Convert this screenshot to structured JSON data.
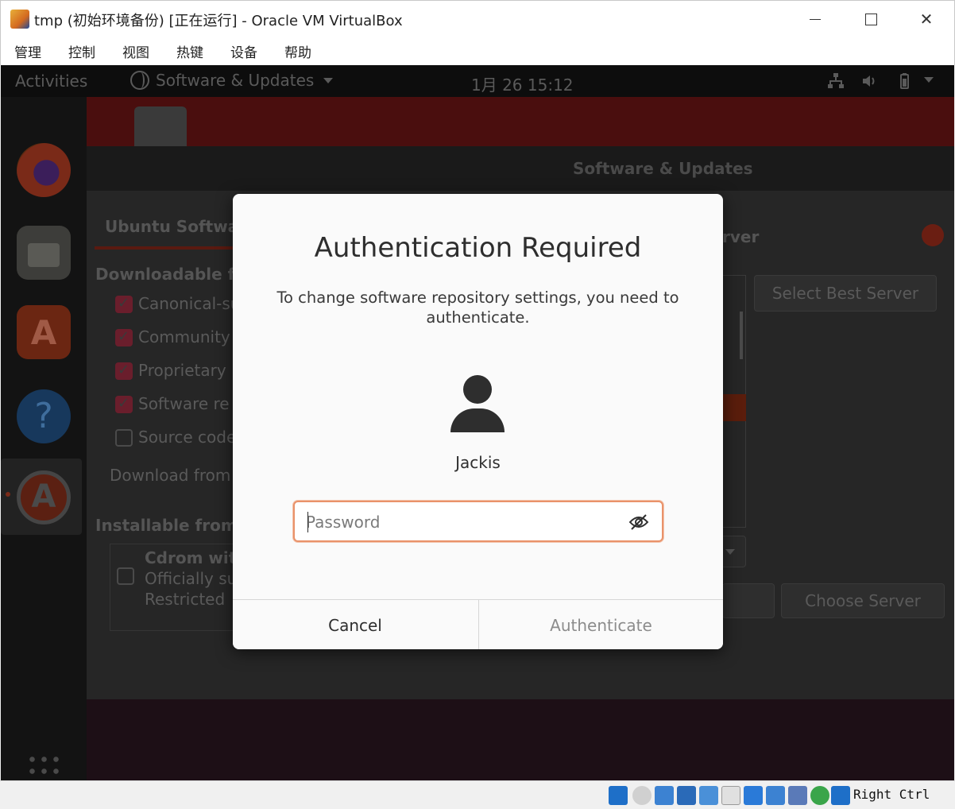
{
  "window": {
    "title": "tmp (初始环境备份) [正在运行] - Oracle VM VirtualBox"
  },
  "menubar": {
    "items": [
      "管理",
      "控制",
      "视图",
      "热键",
      "设备",
      "帮助"
    ]
  },
  "ubuntu_topbar": {
    "activities": "Activities",
    "app_menu": "Software & Updates",
    "clock": "1月 26  15:12"
  },
  "background_window": {
    "title": "Software & Updates",
    "tab_label": "Ubuntu Softwa",
    "downloadable_heading": "Downloadable fr",
    "checkboxes": [
      {
        "label": "Canonical-su",
        "checked": true
      },
      {
        "label": "Community",
        "checked": true
      },
      {
        "label": "Proprietary",
        "checked": true
      },
      {
        "label": "Software re",
        "checked": true
      },
      {
        "label": "Source code",
        "checked": false
      }
    ],
    "download_from": "Download from",
    "installable_heading": "Installable from",
    "cdrom_title": "Cdrom wit",
    "cdrom_line2": "Officially su",
    "cdrom_line3": "Restricted"
  },
  "server_dialog": {
    "title_fragment": "rver",
    "select_best_server": "Select Best Server",
    "choose_server": "Choose Server"
  },
  "auth_dialog": {
    "title": "Authentication Required",
    "description": "To change software repository settings, you need to authenticate.",
    "user_name": "Jackis",
    "password_placeholder": "Password",
    "password_value": "",
    "cancel_label": "Cancel",
    "authenticate_label": "Authenticate",
    "focus_color": "#e9926a"
  },
  "statusbar": {
    "host_key": "Right Ctrl"
  }
}
